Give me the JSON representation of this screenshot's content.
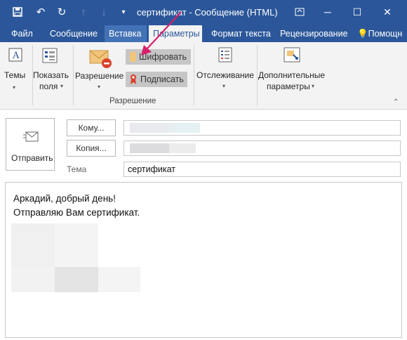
{
  "window": {
    "title": "сертификат - Сообщение (HTML)",
    "min_glyph": "─",
    "max_glyph": "☐",
    "close_glyph": "✕",
    "restore_glyph": "⧉"
  },
  "quick_access": [
    "save-icon",
    "undo-icon",
    "redo-icon",
    "up-arrow-icon",
    "down-arrow-icon",
    "customize-icon"
  ],
  "tabs": [
    {
      "label": "Файл"
    },
    {
      "label": "Сообщение"
    },
    {
      "label": "Вставка"
    },
    {
      "label": "Параметры"
    },
    {
      "label": "Формат текста"
    },
    {
      "label": "Рецензирование"
    },
    {
      "label": "Помощн"
    }
  ],
  "ribbon": {
    "themes_label": "Темы",
    "show_fields_line1": "Показать",
    "show_fields_line2": "поля",
    "permission_label": "Разрешение",
    "encrypt_label": "Шифровать",
    "sign_label": "Подписать",
    "group_permission_title": "Разрешение",
    "tracking_label": "Отслеживание",
    "more_options_line1": "Дополнительные",
    "more_options_line2": "параметры"
  },
  "compose": {
    "send_label": "Отправить",
    "to_label": "Кому...",
    "cc_label": "Копия...",
    "subject_label": "Тема",
    "subject_value": "сертификат",
    "body_line1": "Аркадий, добрый день!",
    "body_line2": "Отправляю Вам сертификат."
  },
  "colors": {
    "accent": "#2b579a",
    "arrow": "#d6206b"
  }
}
